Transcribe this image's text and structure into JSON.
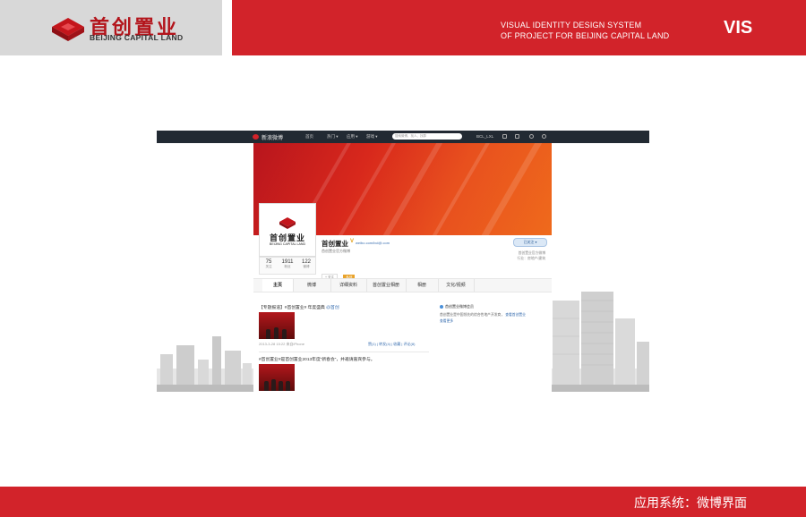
{
  "header": {
    "logo_cn": "首创置业",
    "logo_en": "BEIJING CAPITAL LAND",
    "title_line1": "VISUAL IDENTITY DESIGN SYSTEM",
    "title_line2": "OF PROJECT FOR BEIJING CAPITAL LAND",
    "code": "VIS"
  },
  "footer": {
    "caption": "应用系统：微博界面"
  },
  "weibo": {
    "topbar": {
      "logo": "新浪微博",
      "nav": [
        "首页",
        "热门 ▾",
        "应用 ▾",
        "游戏 ▾"
      ],
      "search_placeholder": "搜索微博、找人、找群",
      "user": "BCL_LXL"
    },
    "profile": {
      "name": "首创置业",
      "verified": "V",
      "url": "weibo.com/bcl@.com",
      "desc": "首创置业官方微博",
      "tags": [
        "+ 关注",
        "私信"
      ],
      "follow_btn": "已关注 ▾",
      "side_line1": "首创置业官方微博",
      "side_line2": "行业：房地产/建筑",
      "avatar_cn": "首创置业",
      "avatar_en": "BEIJING CAPITAL LAND"
    },
    "stats": [
      {
        "num": "75",
        "label": "关注"
      },
      {
        "num": "1911",
        "label": "粉丝"
      },
      {
        "num": "122",
        "label": "微博"
      }
    ],
    "tabs": [
      "主页",
      "微博",
      "详细资料",
      "首创置业相册",
      "相册",
      "文化/视频"
    ],
    "posts": [
      {
        "text": "【专题报道】#首创置业# 年度盛典",
        "link": "@首创",
        "time": "2013-3-28 15:22",
        "source": "来自iPhone",
        "actions": "赞(1) | 转发(4) | 收藏 | 评论(8)"
      },
      {
        "text": "#首创置业#是首创置业2013年度“新春会”，并邀请嘉宾参与。",
        "link": "",
        "time": "",
        "source": "",
        "actions": ""
      }
    ],
    "right_box": {
      "header": "首创置业微博会员",
      "body": "首创置业是中国领先的综合性地产开发商，",
      "link": "查看首创置业",
      "more": "查看更多"
    }
  }
}
